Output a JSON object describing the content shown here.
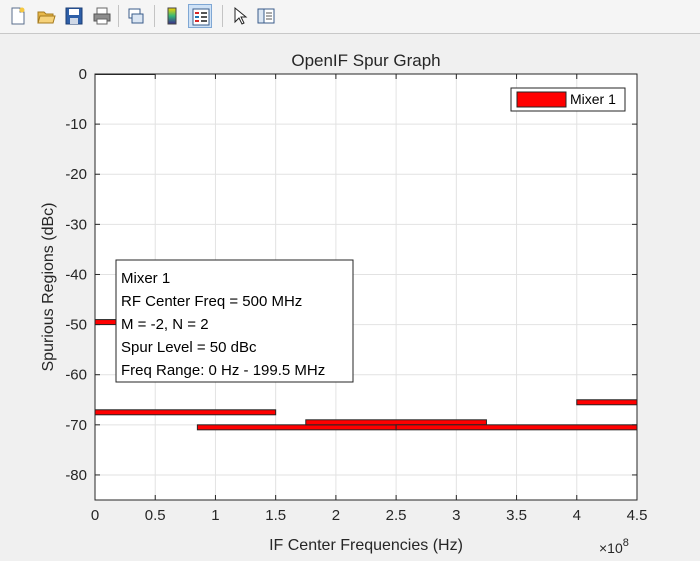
{
  "toolbar": {
    "buttons": [
      {
        "icon": "new-figure-icon"
      },
      {
        "icon": "open-file-icon"
      },
      {
        "icon": "save-icon"
      },
      {
        "icon": "print-icon"
      },
      {
        "icon": "link-plot-icon"
      },
      {
        "icon": "insert-colorbar-icon"
      },
      {
        "icon": "insert-legend-icon",
        "active": true
      },
      {
        "icon": "edit-plot-arrow-icon"
      },
      {
        "icon": "property-inspector-icon"
      }
    ]
  },
  "chart_data": {
    "type": "bar",
    "title": "OpenIF Spur Graph",
    "xlabel": "IF Center Frequencies (Hz)",
    "ylabel": "Spurious Regions (dBc)",
    "x_exponent_label": "×10",
    "x_exponent_power": "8",
    "xlim": [
      0,
      4.5
    ],
    "ylim": [
      -85,
      0
    ],
    "x_scale": 100000000,
    "xticks": [
      {
        "v": 0,
        "label": "0"
      },
      {
        "v": 0.5,
        "label": "0.5"
      },
      {
        "v": 1,
        "label": "1"
      },
      {
        "v": 1.5,
        "label": "1.5"
      },
      {
        "v": 2,
        "label": "2"
      },
      {
        "v": 2.5,
        "label": "2.5"
      },
      {
        "v": 3,
        "label": "3"
      },
      {
        "v": 3.5,
        "label": "3.5"
      },
      {
        "v": 4,
        "label": "4"
      },
      {
        "v": 4.5,
        "label": "4.5"
      }
    ],
    "yticks": [
      {
        "v": 0,
        "label": "0"
      },
      {
        "v": -10,
        "label": "-10"
      },
      {
        "v": -20,
        "label": "-20"
      },
      {
        "v": -30,
        "label": "-30"
      },
      {
        "v": -40,
        "label": "-40"
      },
      {
        "v": -50,
        "label": "-50"
      },
      {
        "v": -60,
        "label": "-60"
      },
      {
        "v": -70,
        "label": "-70"
      },
      {
        "v": -80,
        "label": "-80"
      }
    ],
    "grid": true,
    "legend": {
      "position": "top-right",
      "entries": [
        {
          "label": "Mixer 1",
          "color": "#ff0000"
        }
      ]
    },
    "series": [
      {
        "name": "Mixer 1",
        "color": "#ff0000",
        "bars": [
          {
            "x0": 0.0,
            "x1": 0.5,
            "level": 0
          },
          {
            "x0": 0.0,
            "x1": 0.2,
            "level": -49.5
          },
          {
            "x0": 0.0,
            "x1": 1.5,
            "level": -67.5
          },
          {
            "x0": 0.85,
            "x1": 2.5,
            "level": -70.5
          },
          {
            "x0": 1.75,
            "x1": 3.25,
            "level": -69.5
          },
          {
            "x0": 2.5,
            "x1": 4.5,
            "level": -70.5
          },
          {
            "x0": 4.0,
            "x1": 4.5,
            "level": -65.5
          }
        ]
      }
    ],
    "datatip": {
      "lines": [
        "Mixer 1",
        "RF Center Freq = 500 MHz",
        "M = -2, N = 2",
        "Spur Level = 50 dBc",
        "Freq Range: 0 Hz - 199.5 MHz"
      ]
    }
  }
}
